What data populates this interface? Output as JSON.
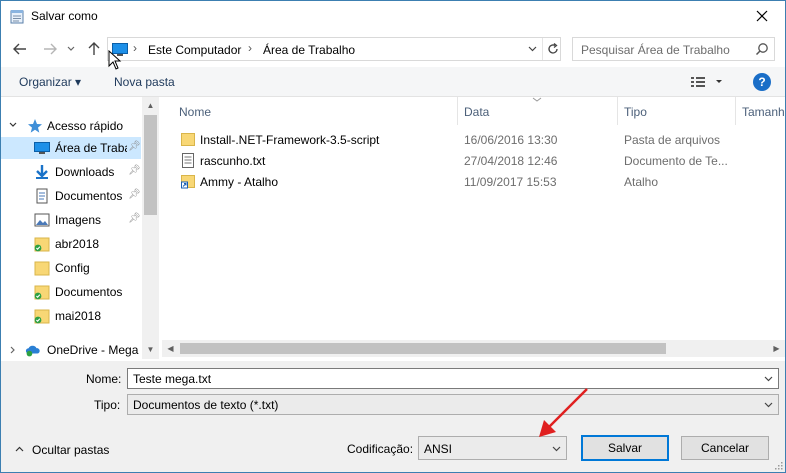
{
  "window": {
    "title": "Salvar como",
    "title_icon": "notepad-icon",
    "close_icon": "close-icon"
  },
  "address": {
    "back_icon": "back-arrow-icon",
    "forward_icon": "forward-arrow-icon",
    "recent_icon": "chevron-down-icon",
    "up_icon": "up-arrow-icon",
    "location_icon": "desktop-icon",
    "crumbs": [
      "Este Computador",
      "Área de Trabalho"
    ],
    "refresh_icon": "refresh-icon"
  },
  "search": {
    "placeholder": "Pesquisar Área de Trabalho",
    "icon": "search-icon"
  },
  "toolbar": {
    "organize": "Organizar ▾",
    "new_folder": "Nova pasta",
    "view_icon": "details-view-icon",
    "help": "?"
  },
  "nav": {
    "quick_access": "Acesso rápido",
    "items": [
      {
        "label": "Área de Trabalho",
        "icon": "desktop-icon",
        "pinned": true,
        "selected": true
      },
      {
        "label": "Downloads",
        "icon": "download-icon",
        "pinned": true
      },
      {
        "label": "Documentos",
        "icon": "documents-icon",
        "pinned": true
      },
      {
        "label": "Imagens",
        "icon": "pictures-icon",
        "pinned": true
      },
      {
        "label": "abr2018",
        "icon": "synced-folder-icon"
      },
      {
        "label": "Config",
        "icon": "folder-icon"
      },
      {
        "label": "Documentos",
        "icon": "synced-folder-icon"
      },
      {
        "label": "mai2018",
        "icon": "synced-folder-icon"
      }
    ],
    "onedrive": "OneDrive - Mega"
  },
  "columns": {
    "name": "Nome",
    "date": "Data",
    "type": "Tipo",
    "size": "Tamanh"
  },
  "files": [
    {
      "name": "Install-.NET-Framework-3.5-script",
      "date": "16/06/2016 13:30",
      "type": "Pasta de arquivos",
      "icon": "folder-icon"
    },
    {
      "name": "rascunho.txt",
      "date": "27/04/2018 12:46",
      "type": "Documento de Te...",
      "icon": "text-file-icon"
    },
    {
      "name": "Ammy - Atalho",
      "date": "11/09/2017 15:53",
      "type": "Atalho",
      "icon": "shortcut-icon"
    }
  ],
  "form": {
    "name_label": "Nome:",
    "name_value": "Teste mega.txt",
    "type_label": "Tipo:",
    "type_value": "Documentos de texto (*.txt)",
    "encoding_label": "Codificação:",
    "encoding_value": "ANSI",
    "save": "Salvar",
    "cancel": "Cancelar",
    "hide_folders": "Ocultar pastas"
  },
  "colors": {
    "accent": "#0078d7",
    "selection": "#cce8ff",
    "annotation_arrow": "#e02020"
  }
}
